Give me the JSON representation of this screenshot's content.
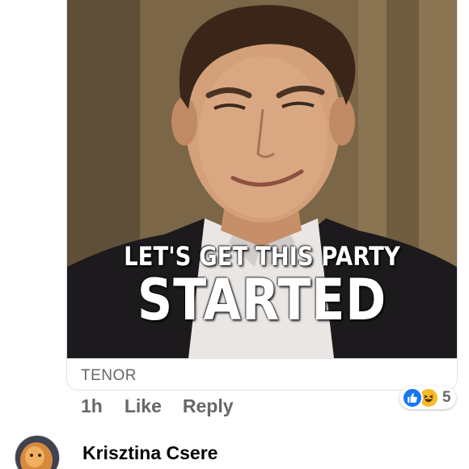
{
  "gif": {
    "caption_line1": "LET'S GET THIS PARTY",
    "caption_line2": "STARTED",
    "source": "TENOR"
  },
  "comment": {
    "timestamp": "1h",
    "like_label": "Like",
    "reply_label": "Reply",
    "reactions": {
      "icons": [
        "like-icon",
        "haha-icon"
      ],
      "count": "5"
    }
  },
  "next_comment": {
    "author": "Krisztina Csere",
    "avatar_icon": "avatar-photo"
  },
  "colors": {
    "like_blue": "#1877f2",
    "haha_yellow": "#f7b928",
    "secondary_text": "#65676b",
    "primary_text": "#050505"
  }
}
